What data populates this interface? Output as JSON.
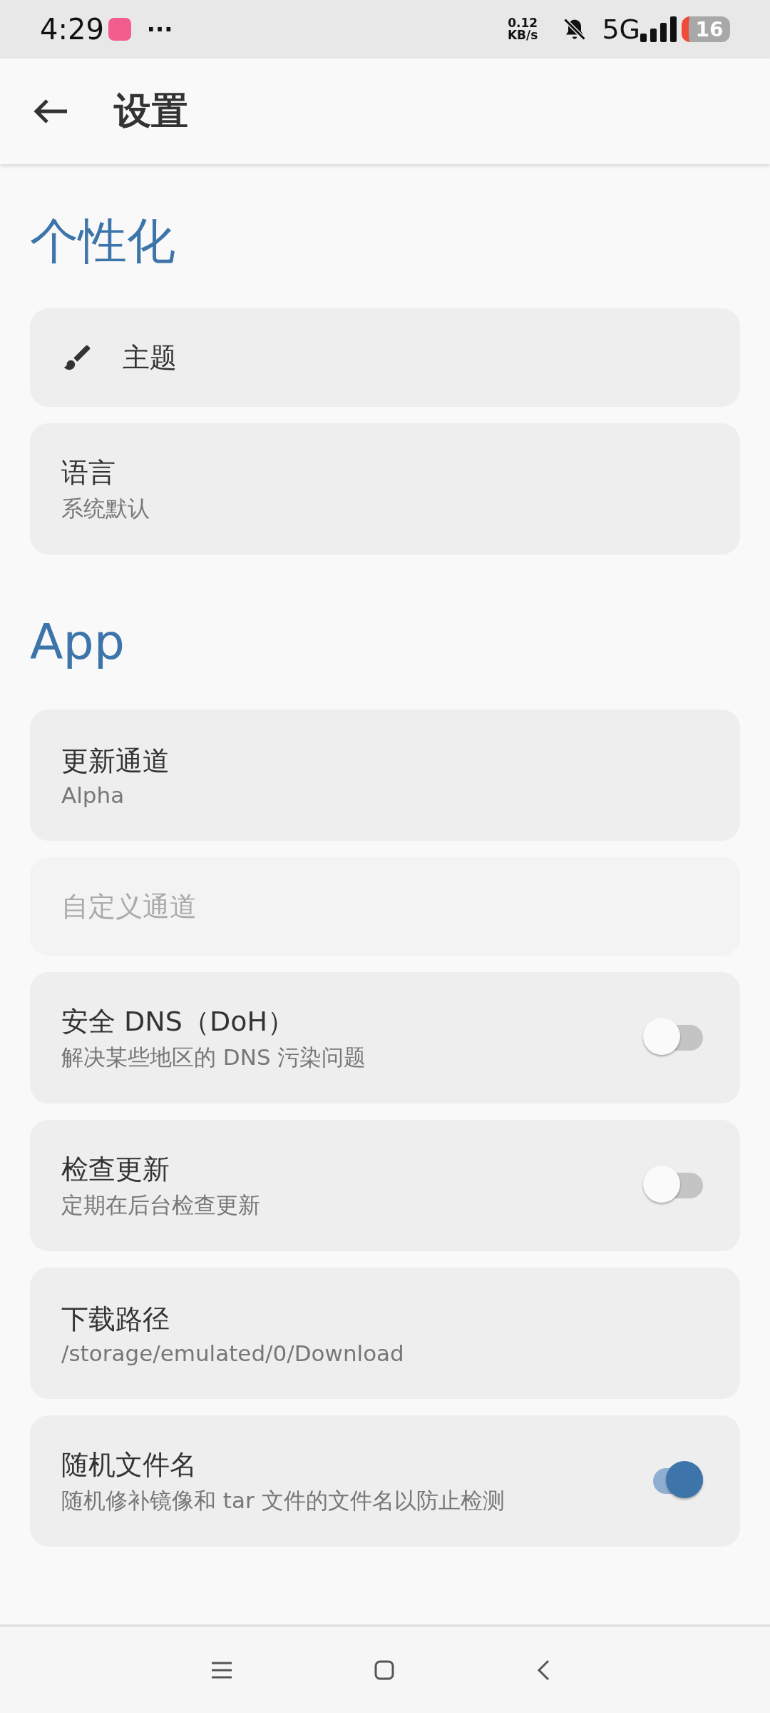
{
  "status_bar": {
    "time": "4:29",
    "more": "···",
    "speed_value": "0.12",
    "speed_unit": "KB/s",
    "network": "5G",
    "battery": "16"
  },
  "app_bar": {
    "title": "设置"
  },
  "sections": [
    {
      "title": "个性化",
      "items": [
        {
          "kind": "icon",
          "title": "主题",
          "disabled": false
        },
        {
          "kind": "nav",
          "title": "语言",
          "subtitle": "系统默认",
          "disabled": false
        }
      ]
    },
    {
      "title": "App",
      "items": [
        {
          "kind": "nav",
          "title": "更新通道",
          "subtitle": "Alpha",
          "disabled": false
        },
        {
          "kind": "nav",
          "title": "自定义通道",
          "disabled": true
        },
        {
          "kind": "switch",
          "title": "安全 DNS（DoH）",
          "subtitle": "解决某些地区的 DNS 污染问题",
          "on": false,
          "disabled": false
        },
        {
          "kind": "switch",
          "title": "检查更新",
          "subtitle": "定期在后台检查更新",
          "on": false,
          "disabled": false
        },
        {
          "kind": "nav",
          "title": "下载路径",
          "subtitle": "/storage/emulated/0/Download",
          "disabled": false
        },
        {
          "kind": "switch",
          "title": "随机文件名",
          "subtitle": "随机修补镜像和 tar 文件的文件名以防止检测",
          "on": true,
          "disabled": false
        }
      ]
    }
  ]
}
